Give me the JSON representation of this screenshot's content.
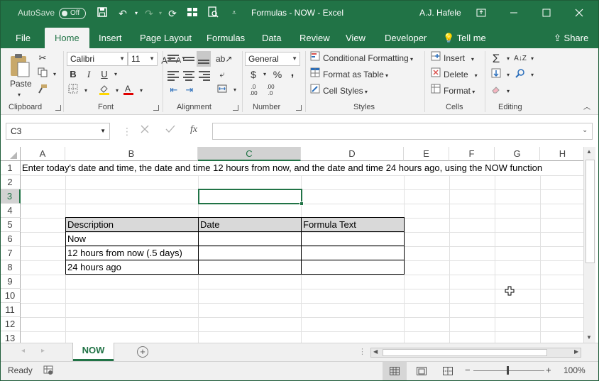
{
  "titlebar": {
    "autosave_label": "AutoSave",
    "autosave_state": "Off",
    "doc_title": "Formulas - NOW  -  Excel",
    "user": "A.J. Hafele"
  },
  "tabs": [
    "File",
    "Home",
    "Insert",
    "Page Layout",
    "Formulas",
    "Data",
    "Review",
    "View",
    "Developer"
  ],
  "tell_me": "Tell me",
  "share": "Share",
  "ribbon": {
    "clipboard": {
      "label": "Clipboard",
      "paste": "Paste"
    },
    "font": {
      "label": "Font",
      "name": "Calibri",
      "size": "11",
      "bold": "B",
      "italic": "I",
      "underline": "U"
    },
    "alignment": {
      "label": "Alignment"
    },
    "number": {
      "label": "Number",
      "format": "General",
      "currency": "$",
      "percent": "%",
      "comma": ",",
      "inc_dec": ".0\n.00",
      "dec_dec": ".00\n.0"
    },
    "styles": {
      "label": "Styles",
      "conditional": "Conditional Formatting",
      "table": "Format as Table",
      "cell_styles": "Cell Styles"
    },
    "cells": {
      "label": "Cells",
      "insert": "Insert",
      "delete": "Delete",
      "format": "Format"
    },
    "editing": {
      "label": "Editing"
    }
  },
  "formula_bar": {
    "name_box": "C3",
    "fx": "fx",
    "formula": ""
  },
  "columns": [
    "A",
    "B",
    "C",
    "D",
    "E",
    "F",
    "G",
    "H"
  ],
  "rows": [
    "1",
    "2",
    "3",
    "4",
    "5",
    "6",
    "7",
    "8",
    "9",
    "10",
    "11",
    "12",
    "13"
  ],
  "cells": {
    "A1": "Enter today's date and time, the date and time 12 hours from now, and the date and time 24 hours ago, using the NOW function"
  },
  "table": {
    "headers": [
      "Description",
      "Date",
      "Formula Text"
    ],
    "rows": [
      [
        "Now",
        "",
        ""
      ],
      [
        "12 hours from now (.5 days)",
        "",
        ""
      ],
      [
        "24 hours ago",
        "",
        ""
      ]
    ]
  },
  "sheet": {
    "active": "NOW"
  },
  "status": {
    "ready": "Ready",
    "zoom": "100%",
    "zoom_level": 100
  }
}
